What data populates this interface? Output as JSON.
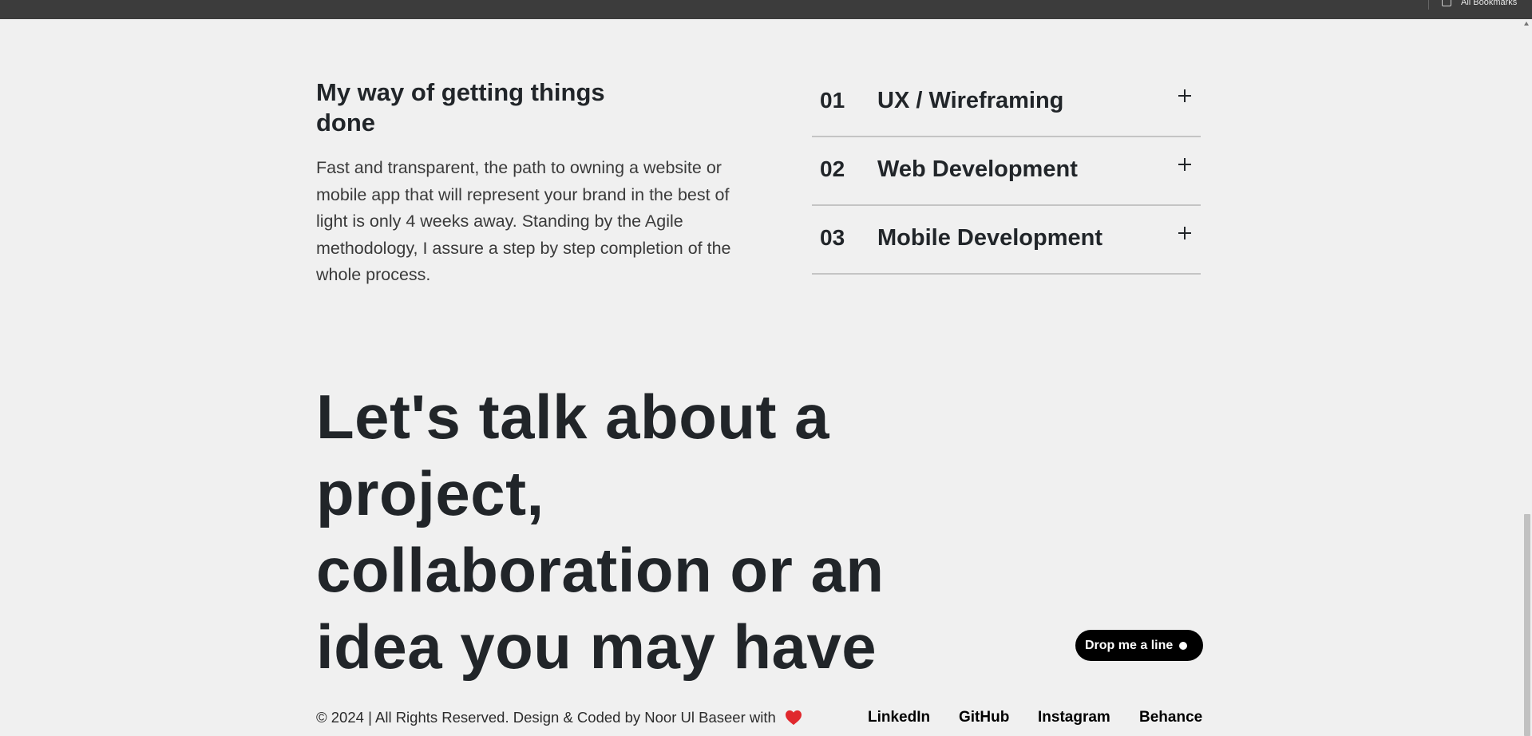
{
  "browser": {
    "bookmarks_label": "All Bookmarks"
  },
  "process": {
    "heading": "My way of getting things done",
    "text": "Fast and transparent, the path to owning a website or mobile app that will represent your brand in the best of light is only 4 weeks away. Standing by the Agile methodology, I assure a step by step completion of the whole process."
  },
  "services": [
    {
      "num": "01",
      "title": "UX / Wireframing",
      "icon": "plus-icon"
    },
    {
      "num": "02",
      "title": "Web Development",
      "icon": "plus-icon"
    },
    {
      "num": "03",
      "title": "Mobile Development",
      "icon": "plus-icon"
    }
  ],
  "cta": {
    "heading": "Let's talk about a project, collaboration or an idea you may have",
    "button_label": "Drop me a line"
  },
  "footer": {
    "copyright": "© 2024 | All Rights Reserved. Design & Coded by Noor Ul Baseer with",
    "heart_icon": "heart-icon",
    "links": [
      "LinkedIn",
      "GitHub",
      "Instagram",
      "Behance"
    ]
  },
  "colors": {
    "background": "#f0f0f0",
    "text": "#212529",
    "accent_button": "#000000",
    "heart": "#e0282d"
  }
}
